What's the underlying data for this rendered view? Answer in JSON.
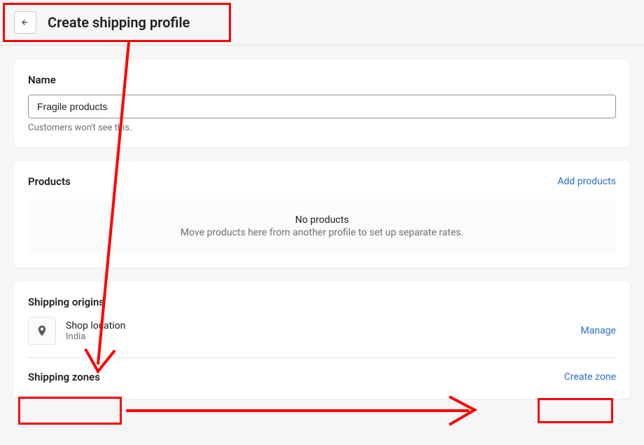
{
  "header": {
    "title": "Create shipping profile"
  },
  "name_section": {
    "label": "Name",
    "value": "Fragile products",
    "help": "Customers won't see this."
  },
  "products_section": {
    "title": "Products",
    "action": "Add products",
    "empty_title": "No products",
    "empty_sub": "Move products here from another profile to set up separate rates."
  },
  "origins_section": {
    "title": "Shipping origins",
    "location_name": "Shop location",
    "location_country": "India",
    "manage": "Manage"
  },
  "zones_section": {
    "title": "Shipping zones",
    "action": "Create zone"
  }
}
